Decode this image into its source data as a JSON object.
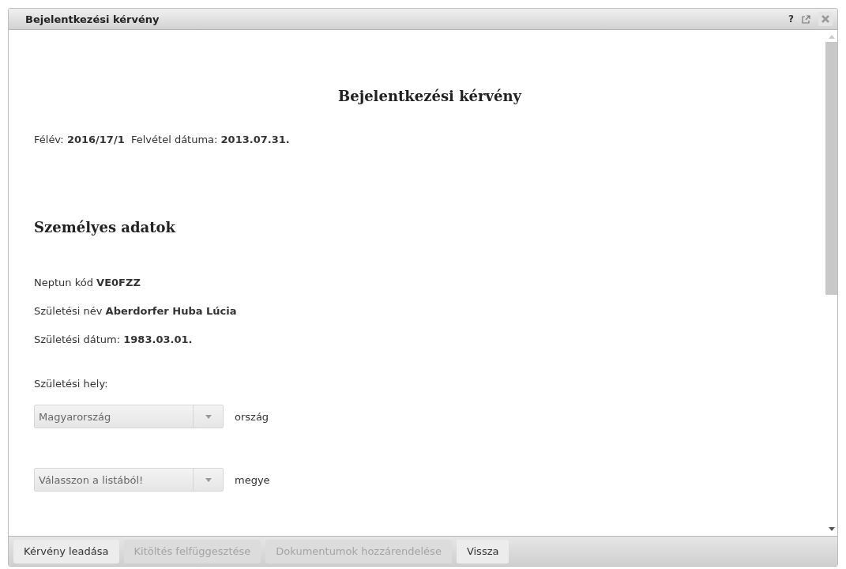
{
  "window": {
    "title": "Bejelentkezési kérvény",
    "help": "?"
  },
  "form": {
    "title": "Bejelentkezési kérvény",
    "meta": "Félév: **2016/17/1**  Felvétel dátuma: **2013.07.31.**",
    "section": "Személyes adatok",
    "fields": [
      "Neptun kód **VE0FZZ**",
      "Születési név **Aberdorfer Huba Lúcia**",
      "Születési dátum: **1983.03.01.**"
    ],
    "place_label": "Születési hely:",
    "selects": [
      {
        "value": "Magyarország",
        "suffix": "ország"
      },
      {
        "value": "Válasszon a listából!",
        "suffix": "megye"
      }
    ]
  },
  "buttons": [
    {
      "label": "Kérvény leadása",
      "disabled": false
    },
    {
      "label": "Kitöltés felfüggesztése",
      "disabled": true
    },
    {
      "label": "Dokumentumok hozzárendelése",
      "disabled": true
    },
    {
      "label": "Vissza",
      "disabled": false
    }
  ]
}
